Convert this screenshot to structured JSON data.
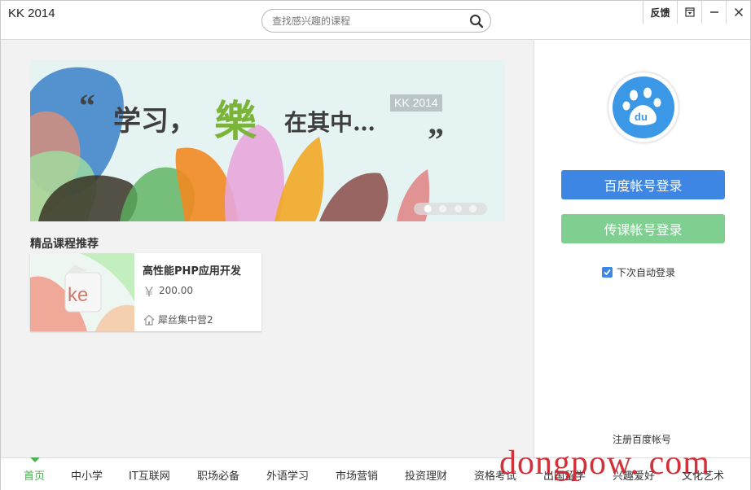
{
  "app": {
    "title": "KK 2014"
  },
  "search": {
    "placeholder": "查找感兴趣的课程",
    "icon": "search-icon"
  },
  "window_controls": {
    "feedback_label": "反馈"
  },
  "banner": {
    "slogan_part1": "学习，",
    "slogan_char": "樂",
    "slogan_part2": "在其中…",
    "badge": "KK 2014",
    "slide_count": 4,
    "active_slide": 1
  },
  "recommend": {
    "title": "精品课程推荐",
    "courses": [
      {
        "name": "高性能PHP应用开发",
        "price": "200.00",
        "currency": "￥",
        "provider": "犀丝集中营2",
        "thumb_text": "ke"
      }
    ]
  },
  "login": {
    "baidu_button": "百度帐号登录",
    "ke_button": "传课帐号登录",
    "auto_login_label": "下次自动登录",
    "auto_login_checked": true,
    "register_link": "注册百度帐号"
  },
  "nav": {
    "items": [
      "首页",
      "中小学",
      "IT互联网",
      "职场必备",
      "外语学习",
      "市场营销",
      "投资理财",
      "资格考试",
      "出国留学",
      "兴趣爱好",
      "文化艺术"
    ],
    "active_index": 0
  },
  "watermark": {
    "text": "dongpow. com"
  },
  "colors": {
    "accent_green": "#4caf50",
    "baidu_blue": "#3d86e3",
    "ke_green": "#7fcf91",
    "watermark_red": "#d0202a"
  }
}
